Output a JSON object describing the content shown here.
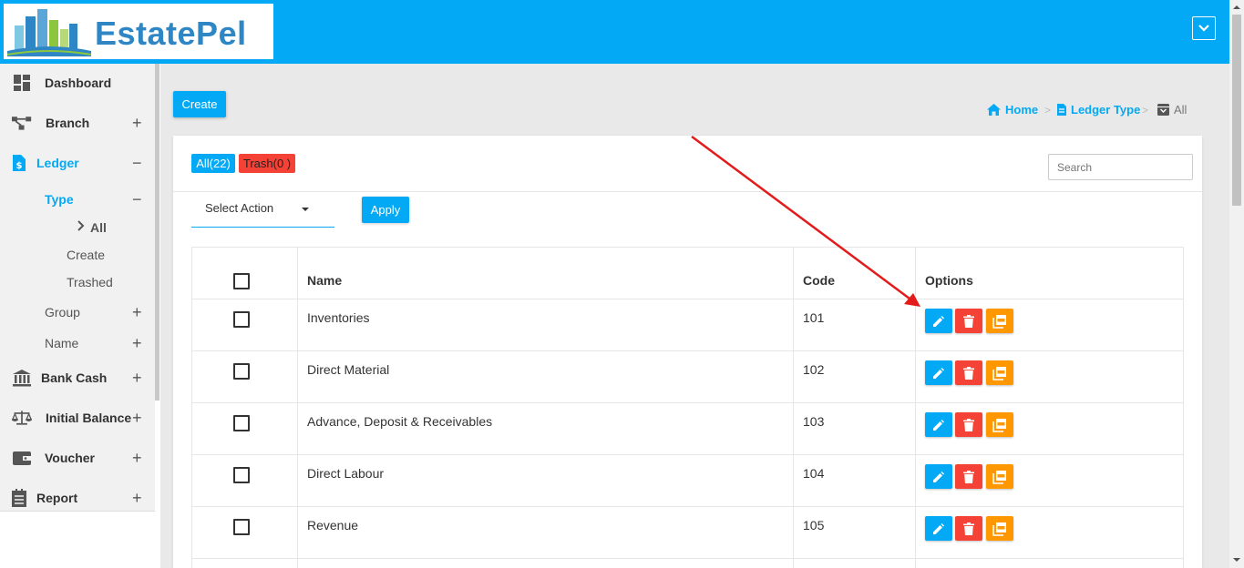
{
  "header": {
    "brand": "EstatePel"
  },
  "sidebar": {
    "items": [
      {
        "label": "Dashboard"
      },
      {
        "label": "Branch"
      },
      {
        "label": "Ledger"
      },
      {
        "label": "Bank Cash"
      },
      {
        "label": "Initial Balance"
      },
      {
        "label": "Voucher"
      },
      {
        "label": "Report"
      }
    ],
    "ledger_sub": {
      "type": "Type",
      "type_items": [
        "All",
        "Create",
        "Trashed"
      ],
      "group": "Group",
      "name": "Name"
    }
  },
  "toolbar": {
    "create_label": "Create",
    "apply_label": "Apply",
    "select_action": "Select Action"
  },
  "breadcrumb": {
    "home": "Home",
    "ledger_type": "Ledger Type",
    "current": "All"
  },
  "filters": {
    "all": "All(22)",
    "trash": "Trash(0 )"
  },
  "search": {
    "placeholder": "Search"
  },
  "table": {
    "headers": {
      "name": "Name",
      "code": "Code",
      "options": "Options"
    },
    "rows": [
      {
        "name": "Inventories",
        "code": "101"
      },
      {
        "name": "Direct Material",
        "code": "102"
      },
      {
        "name": "Advance, Deposit & Receivables",
        "code": "103"
      },
      {
        "name": "Direct Labour",
        "code": "104"
      },
      {
        "name": "Revenue",
        "code": "105"
      }
    ]
  },
  "colors": {
    "accent": "#03a9f4",
    "danger": "#f44336",
    "warning": "#ff9800",
    "annotation": "#e41b1b"
  }
}
